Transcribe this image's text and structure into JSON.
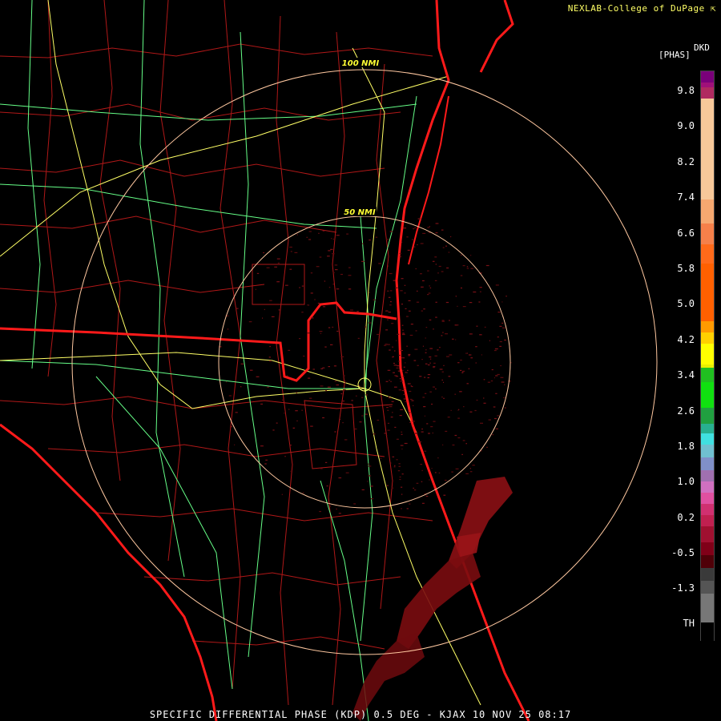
{
  "credit": "NEXLAB-College of DuPage",
  "credit_icon": "cursor-arrow-icon",
  "product": {
    "code": "DKD",
    "unit": "[PHAS]"
  },
  "range_rings": [
    {
      "label": "100 NMI"
    },
    {
      "label": "50 NMI"
    }
  ],
  "colorbar": {
    "ticks": [
      "9.8",
      "9.0",
      "8.2",
      "7.4",
      "6.6",
      "5.8",
      "5.0",
      "4.2",
      "3.4",
      "2.6",
      "1.8",
      "1.0",
      "0.2",
      "-0.5",
      "-1.3",
      "TH"
    ]
  },
  "footer": "SPECIFIC DIFFERENTIAL PHASE (KDP) 0.5 DEG - KJAX 10 NOV 25 08:17",
  "colors": {
    "state_border": "#ff1a1a",
    "county_lines": "#b01818",
    "interstates": "#ffff66",
    "highways": "#66ff88",
    "range_rings": "#ffc8a0",
    "label": "#ffff33"
  }
}
